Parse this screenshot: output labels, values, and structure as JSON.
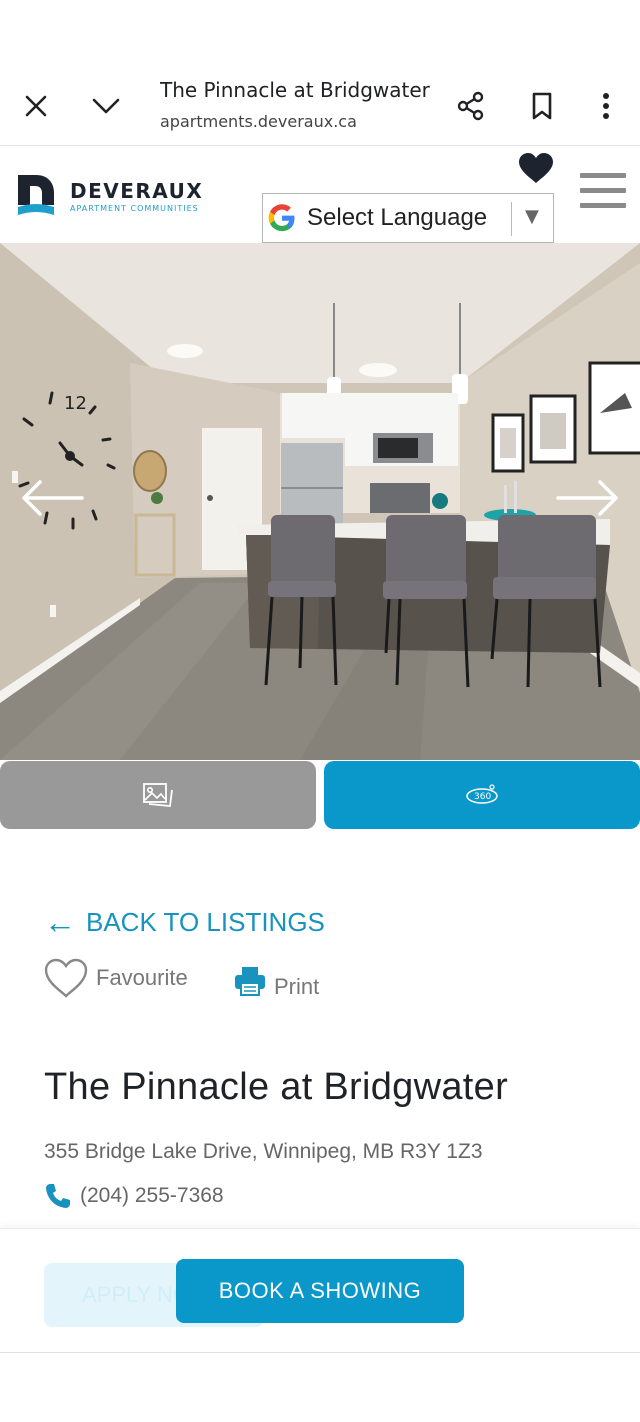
{
  "browser": {
    "title": "The Pinnacle at Bridgwater",
    "url": "apartments.deveraux.ca"
  },
  "header": {
    "brand_name": "DEVERAUX",
    "brand_sub": "APARTMENT COMMUNITIES",
    "language_select": "Select Language"
  },
  "listing": {
    "back_label": "BACK TO LISTINGS",
    "favourite_label": "Favourite",
    "print_label": "Print",
    "title": "The Pinnacle at Bridgwater",
    "address": "355 Bridge Lake Drive, Winnipeg, MB R3Y 1Z3",
    "phone": "(204) 255-7368"
  },
  "actions": {
    "apply_label": "APPLY NOW",
    "book_label": "BOOK A SHOWING"
  },
  "colors": {
    "accent": "#0a97c9",
    "link": "#1893bf",
    "photo_button": "#999999"
  },
  "icons": [
    "close-icon",
    "chevron-down-icon",
    "share-icon",
    "bookmark-icon",
    "more-vert-icon",
    "heart-icon",
    "menu-icon",
    "google-icon",
    "dropdown-arrow-icon",
    "arrow-left-icon",
    "arrow-right-icon",
    "photos-icon",
    "view-360-icon",
    "heart-outline-icon",
    "printer-icon",
    "phone-icon"
  ]
}
